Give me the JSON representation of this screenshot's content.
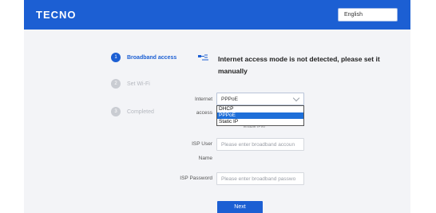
{
  "header": {
    "logo": "TECNO",
    "language": "English"
  },
  "steps": [
    {
      "number": "1",
      "label": "Broadband access"
    },
    {
      "number": "2",
      "label": "Set Wi-Fi"
    },
    {
      "number": "3",
      "label": "Completed"
    }
  ],
  "notice": "Internet access mode is not detected, please set it manually",
  "form": {
    "internet_access_label_1": "Internet",
    "internet_access_label_2": "access",
    "internet_access_value": "PPPoE",
    "options": [
      "DHCP",
      "PPPoE",
      "Static IP"
    ],
    "hidden_text": "Enable IPv6",
    "isp_user_label_1": "ISP User",
    "isp_user_label_2": "Name",
    "isp_user_placeholder": "Please enter broadband accoun",
    "isp_password_label": "ISP Password",
    "isp_password_placeholder": "Please enter broadband passwo"
  },
  "next_label": "Next",
  "colors": {
    "brand": "#1c5fd3",
    "background": "#f3f4f7",
    "selected_option": "#1e6fd9"
  }
}
